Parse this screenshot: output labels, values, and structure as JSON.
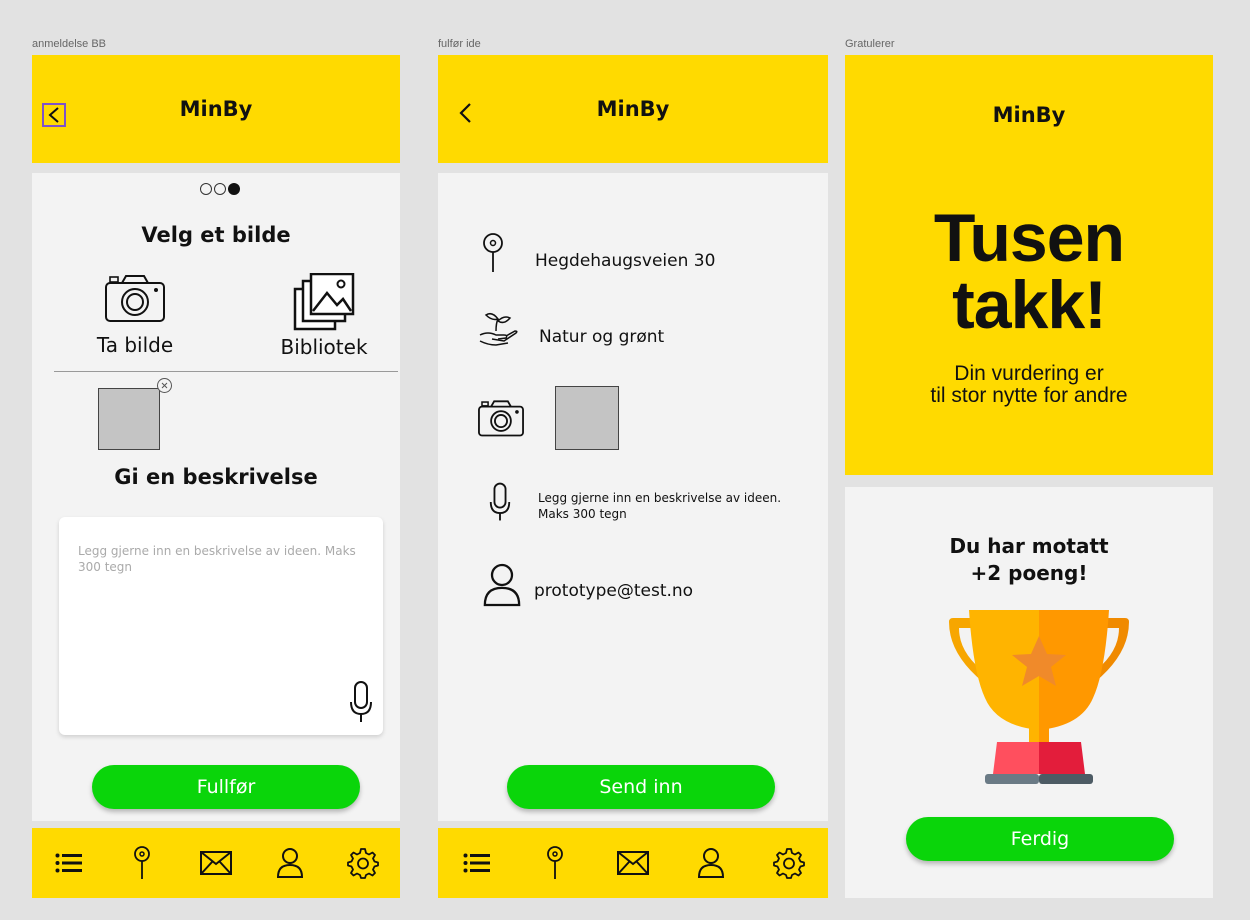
{
  "frames": {
    "screen1": "anmeldelse BB",
    "screen2": "fulfør ide",
    "screen3": "Gratulerer"
  },
  "app_title": "MinBy",
  "screen1": {
    "heading_image": "Velg et bilde",
    "take_photo_label": "Ta bilde",
    "library_label": "Bibliotek",
    "heading_description": "Gi en beskrivelse",
    "description_placeholder": "Legg gjerne inn en beskrivelse av  ideen. Maks 300 tegn",
    "submit_label": "Fullfør",
    "progress": {
      "steps": 3,
      "current": 3
    }
  },
  "screen2": {
    "address": "Hegdehaugsveien 30",
    "category": "Natur og grønt",
    "description_line1": "Legg gjerne inn en beskrivelse av  ideen.",
    "description_line2": "Maks 300 tegn",
    "email": "prototype@test.no",
    "submit_label": "Send inn"
  },
  "screen3": {
    "thanks_line1": "Tusen",
    "thanks_line2": "takk!",
    "subtitle_line1": "Din vurdering er",
    "subtitle_line2": "til stor nytte for andre",
    "points_line1": "Du har motatt",
    "points_line2": "+2 poeng!",
    "done_label": "Ferdig"
  },
  "nav_icons": [
    "list-icon",
    "map-pin-icon",
    "mail-icon",
    "profile-icon",
    "settings-icon"
  ],
  "colors": {
    "brand_yellow": "#ffda00",
    "button_green": "#0ad50a",
    "content_bg": "#f3f3f3",
    "canvas_bg": "#e2e2e2"
  }
}
